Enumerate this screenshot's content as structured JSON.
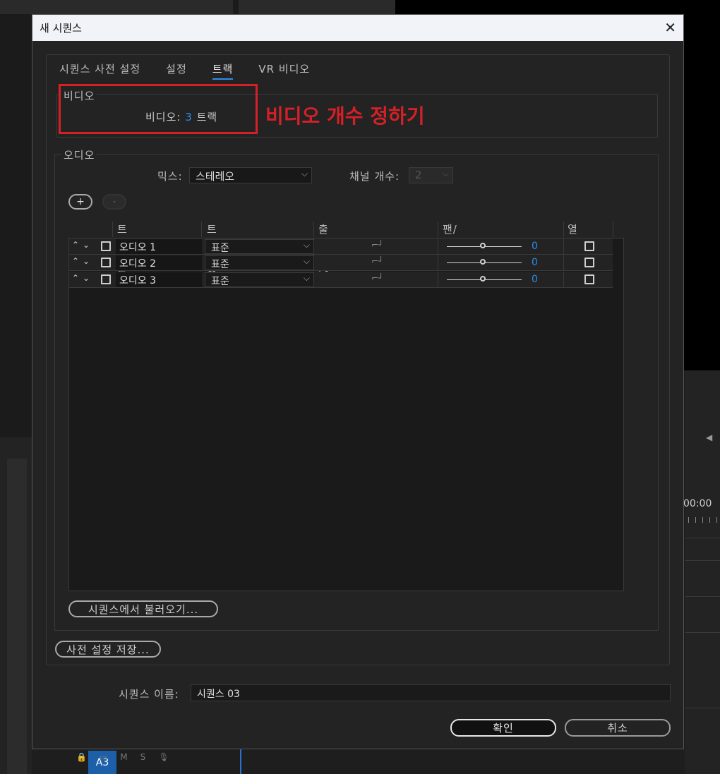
{
  "background": {
    "timecode": "00:00",
    "track_label": "A3",
    "track_icons": [
      "M",
      "S"
    ]
  },
  "dialog": {
    "title": "새 시퀀스",
    "close_icon": "close-icon",
    "tabs": [
      {
        "label": "시퀀스 사전 설정"
      },
      {
        "label": "설정"
      },
      {
        "label": "트랙",
        "active": true
      },
      {
        "label": "VR 비디오"
      }
    ],
    "video": {
      "group_label": "비디오",
      "field_label": "비디오:",
      "count": "3",
      "unit": "트랙"
    },
    "annotation": "비디오 개수 정하기",
    "audio": {
      "group_label": "오디오",
      "mix_label": "믹스:",
      "mix_value": "스테레오",
      "channel_label": "채널 개수:",
      "channel_value": "2",
      "add_button": "+",
      "remove_button": "-",
      "columns": [
        "트랙 이름",
        "트랙 유형",
        "출력 할당",
        "팬/균형",
        "열기"
      ],
      "rows": [
        {
          "name": "오디오 1",
          "type": "표준",
          "pan": "0"
        },
        {
          "name": "오디오 2",
          "type": "표준",
          "pan": "0"
        },
        {
          "name": "오디오 3",
          "type": "표준",
          "pan": "0"
        }
      ],
      "import_button": "시퀀스에서 불러오기..."
    },
    "save_preset_button": "사전 설정 저장...",
    "sequence_name_label": "시퀀스 이름:",
    "sequence_name_value": "시퀀스 03",
    "ok_button": "확인",
    "cancel_button": "취소"
  },
  "colors": {
    "accent": "#2d8ceb",
    "annotation": "#d62028"
  }
}
